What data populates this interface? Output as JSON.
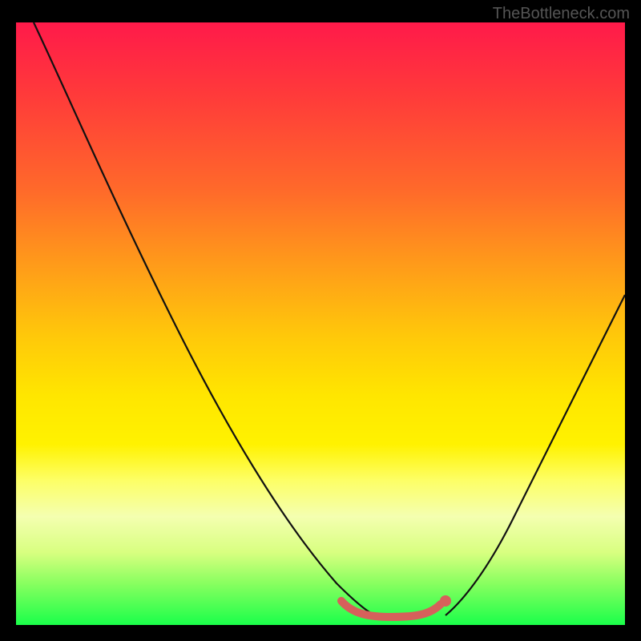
{
  "watermark": "TheBottleneck.com",
  "chart_data": {
    "type": "line",
    "title": "",
    "xlabel": "",
    "ylabel": "",
    "xlim": [
      0,
      100
    ],
    "ylim": [
      0,
      100
    ],
    "grid": false,
    "legend": null,
    "series": [
      {
        "name": "left-curve",
        "x": [
          3,
          10,
          20,
          30,
          40,
          50,
          54,
          58,
          60
        ],
        "y": [
          100,
          83,
          63,
          45,
          29,
          13,
          7,
          3,
          2
        ]
      },
      {
        "name": "right-curve",
        "x": [
          60,
          64,
          68,
          74,
          80,
          86,
          92,
          98,
          100
        ],
        "y": [
          2,
          3,
          5,
          10,
          18,
          28,
          39,
          51,
          55
        ]
      },
      {
        "name": "optimal-band",
        "x": [
          53,
          56,
          59,
          61,
          63,
          65,
          67,
          70
        ],
        "y": [
          3,
          1.5,
          1,
          1,
          1,
          1.2,
          1.8,
          3
        ]
      }
    ],
    "colors": {
      "gradient_top": "#ff1a4a",
      "gradient_mid": "#ffe600",
      "gradient_bottom": "#1aff4a",
      "curve": "#111111",
      "indicator": "#d6605b",
      "background": "#000000"
    }
  }
}
